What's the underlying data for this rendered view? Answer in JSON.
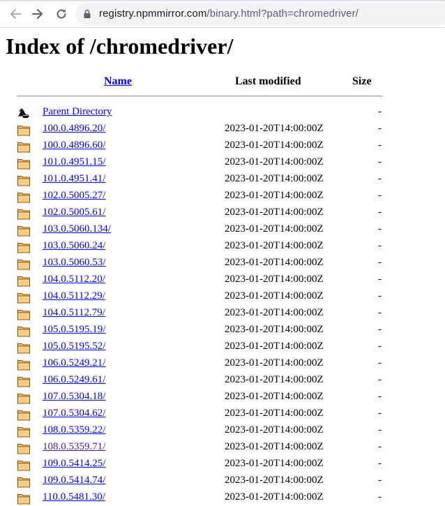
{
  "browser": {
    "url_host": "registry.npmmirror.com",
    "url_path": "/binary.html?path=chromedriver/",
    "icons": {
      "back": "arrow-left-icon",
      "forward": "arrow-right-icon",
      "reload": "reload-icon",
      "security": "lock-icon"
    }
  },
  "page": {
    "title": "Index of /chromedriver/",
    "columns": {
      "name": "Name",
      "modified": "Last modified",
      "size": "Size"
    },
    "parent": {
      "label": "Parent Directory",
      "size": "-",
      "icon": "parent-directory-icon"
    },
    "entries": [
      {
        "name": "100.0.4896.20/",
        "modified": "2023-01-20T14:00:00Z",
        "size": "-",
        "visited": false
      },
      {
        "name": "100.0.4896.60/",
        "modified": "2023-01-20T14:00:00Z",
        "size": "-",
        "visited": false
      },
      {
        "name": "101.0.4951.15/",
        "modified": "2023-01-20T14:00:00Z",
        "size": "-",
        "visited": false
      },
      {
        "name": "101.0.4951.41/",
        "modified": "2023-01-20T14:00:00Z",
        "size": "-",
        "visited": false
      },
      {
        "name": "102.0.5005.27/",
        "modified": "2023-01-20T14:00:00Z",
        "size": "-",
        "visited": false
      },
      {
        "name": "102.0.5005.61/",
        "modified": "2023-01-20T14:00:00Z",
        "size": "-",
        "visited": false
      },
      {
        "name": "103.0.5060.134/",
        "modified": "2023-01-20T14:00:00Z",
        "size": "-",
        "visited": false
      },
      {
        "name": "103.0.5060.24/",
        "modified": "2023-01-20T14:00:00Z",
        "size": "-",
        "visited": false
      },
      {
        "name": "103.0.5060.53/",
        "modified": "2023-01-20T14:00:00Z",
        "size": "-",
        "visited": false
      },
      {
        "name": "104.0.5112.20/",
        "modified": "2023-01-20T14:00:00Z",
        "size": "-",
        "visited": false
      },
      {
        "name": "104.0.5112.29/",
        "modified": "2023-01-20T14:00:00Z",
        "size": "-",
        "visited": false
      },
      {
        "name": "104.0.5112.79/",
        "modified": "2023-01-20T14:00:00Z",
        "size": "-",
        "visited": false
      },
      {
        "name": "105.0.5195.19/",
        "modified": "2023-01-20T14:00:00Z",
        "size": "-",
        "visited": false
      },
      {
        "name": "105.0.5195.52/",
        "modified": "2023-01-20T14:00:00Z",
        "size": "-",
        "visited": false
      },
      {
        "name": "106.0.5249.21/",
        "modified": "2023-01-20T14:00:00Z",
        "size": "-",
        "visited": false
      },
      {
        "name": "106.0.5249.61/",
        "modified": "2023-01-20T14:00:00Z",
        "size": "-",
        "visited": false
      },
      {
        "name": "107.0.5304.18/",
        "modified": "2023-01-20T14:00:00Z",
        "size": "-",
        "visited": false
      },
      {
        "name": "107.0.5304.62/",
        "modified": "2023-01-20T14:00:00Z",
        "size": "-",
        "visited": false
      },
      {
        "name": "108.0.5359.22/",
        "modified": "2023-01-20T14:00:00Z",
        "size": "-",
        "visited": false
      },
      {
        "name": "108.0.5359.71/",
        "modified": "2023-01-20T14:00:00Z",
        "size": "-",
        "visited": true
      },
      {
        "name": "109.0.5414.25/",
        "modified": "2023-01-20T14:00:00Z",
        "size": "-",
        "visited": false
      },
      {
        "name": "109.0.5414.74/",
        "modified": "2023-01-20T14:00:00Z",
        "size": "-",
        "visited": false
      },
      {
        "name": "110.0.5481.30/",
        "modified": "2023-01-20T14:00:00Z",
        "size": "-",
        "visited": false
      }
    ],
    "entry_icon": "folder-icon"
  },
  "colors": {
    "link": "#0000ee",
    "visited_link": "#551a8b",
    "folder_fill": "#f4b961",
    "folder_stroke": "#8a5a12"
  }
}
